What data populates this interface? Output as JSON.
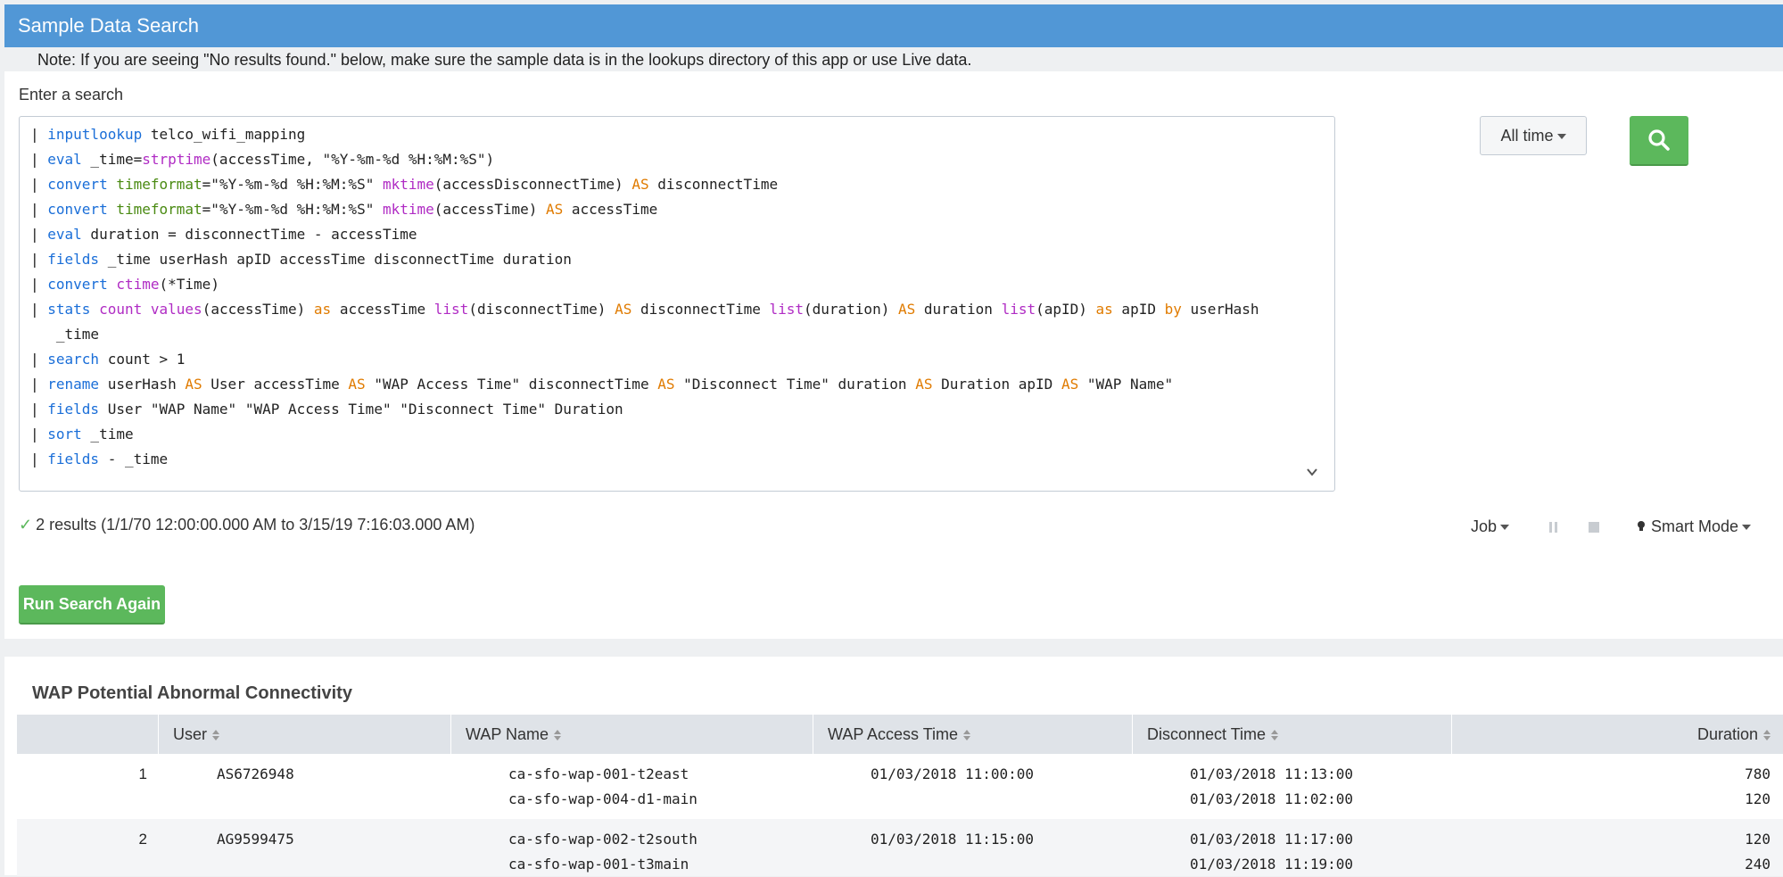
{
  "header": {
    "title": "Sample Data Search"
  },
  "note": "Note: If you are seeing \"No results found.\" below, make sure the sample data is in the lookups directory of this app or use Live data.",
  "search": {
    "label": "Enter a search",
    "lines": [
      [
        [
          "p",
          "| "
        ],
        [
          "kw",
          "inputlookup"
        ],
        [
          "p",
          " telco_wifi_mapping"
        ]
      ],
      [
        [
          "p",
          "| "
        ],
        [
          "kw",
          "eval"
        ],
        [
          "p",
          " _time="
        ],
        [
          "fn",
          "strptime"
        ],
        [
          "p",
          "(accessTime, \"%Y-%m-%d %H:%M:%S\")"
        ]
      ],
      [
        [
          "p",
          "| "
        ],
        [
          "kw",
          "convert"
        ],
        [
          "p",
          " "
        ],
        [
          "str",
          "timeformat"
        ],
        [
          "p",
          "=\"%Y-%m-%d %H:%M:%S\" "
        ],
        [
          "fn",
          "mktime"
        ],
        [
          "p",
          "(accessDisconnectTime) "
        ],
        [
          "op",
          "AS"
        ],
        [
          "p",
          " disconnectTime"
        ]
      ],
      [
        [
          "p",
          "| "
        ],
        [
          "kw",
          "convert"
        ],
        [
          "p",
          " "
        ],
        [
          "str",
          "timeformat"
        ],
        [
          "p",
          "=\"%Y-%m-%d %H:%M:%S\" "
        ],
        [
          "fn",
          "mktime"
        ],
        [
          "p",
          "(accessTime) "
        ],
        [
          "op",
          "AS"
        ],
        [
          "p",
          " accessTime"
        ]
      ],
      [
        [
          "p",
          "| "
        ],
        [
          "kw",
          "eval"
        ],
        [
          "p",
          " duration = disconnectTime - accessTime"
        ]
      ],
      [
        [
          "p",
          "| "
        ],
        [
          "kw",
          "fields"
        ],
        [
          "p",
          " _time userHash apID accessTime disconnectTime duration"
        ]
      ],
      [
        [
          "p",
          "| "
        ],
        [
          "kw",
          "convert"
        ],
        [
          "p",
          " "
        ],
        [
          "fn",
          "ctime"
        ],
        [
          "p",
          "(*Time)"
        ]
      ],
      [
        [
          "p",
          "| "
        ],
        [
          "kw",
          "stats"
        ],
        [
          "p",
          " "
        ],
        [
          "fn",
          "count"
        ],
        [
          "p",
          " "
        ],
        [
          "fn",
          "values"
        ],
        [
          "p",
          "(accessTime) "
        ],
        [
          "op",
          "as"
        ],
        [
          "p",
          " accessTime "
        ],
        [
          "fn",
          "list"
        ],
        [
          "p",
          "(disconnectTime) "
        ],
        [
          "op",
          "AS"
        ],
        [
          "p",
          " disconnectTime "
        ],
        [
          "fn",
          "list"
        ],
        [
          "p",
          "(duration) "
        ],
        [
          "op",
          "AS"
        ],
        [
          "p",
          " duration "
        ],
        [
          "fn",
          "list"
        ],
        [
          "p",
          "(apID) "
        ],
        [
          "op",
          "as"
        ],
        [
          "p",
          " apID "
        ],
        [
          "op",
          "by"
        ],
        [
          "p",
          " userHash"
        ]
      ],
      [
        [
          "p",
          "   _time"
        ]
      ],
      [
        [
          "p",
          "| "
        ],
        [
          "kw",
          "search"
        ],
        [
          "p",
          " count > 1"
        ]
      ],
      [
        [
          "p",
          "| "
        ],
        [
          "kw",
          "rename"
        ],
        [
          "p",
          " userHash "
        ],
        [
          "op",
          "AS"
        ],
        [
          "p",
          " User accessTime "
        ],
        [
          "op",
          "AS"
        ],
        [
          "p",
          " \"WAP Access Time\" disconnectTime "
        ],
        [
          "op",
          "AS"
        ],
        [
          "p",
          " \"Disconnect Time\" duration "
        ],
        [
          "op",
          "AS"
        ],
        [
          "p",
          " Duration apID "
        ],
        [
          "op",
          "AS"
        ],
        [
          "p",
          " \"WAP Name\""
        ]
      ],
      [
        [
          "p",
          "| "
        ],
        [
          "kw",
          "fields"
        ],
        [
          "p",
          " User \"WAP Name\" \"WAP Access Time\" \"Disconnect Time\" Duration"
        ]
      ],
      [
        [
          "p",
          "| "
        ],
        [
          "kw",
          "sort"
        ],
        [
          "p",
          " _time"
        ]
      ],
      [
        [
          "p",
          "| "
        ],
        [
          "kw",
          "fields"
        ],
        [
          "p",
          " - _time"
        ]
      ]
    ]
  },
  "time_picker": {
    "label": "All time"
  },
  "status": {
    "results_text": "2 results (1/1/70 12:00:00.000 AM to 3/15/19 7:16:03.000 AM)"
  },
  "job_menu": {
    "label": "Job"
  },
  "mode_menu": {
    "label": "Smart Mode"
  },
  "run_button": {
    "label": "Run Search Again"
  },
  "results": {
    "title": "WAP Potential Abnormal Connectivity",
    "columns": [
      "User",
      "WAP Name",
      "WAP Access Time",
      "Disconnect Time",
      "Duration"
    ],
    "rows": [
      {
        "index": "1",
        "user": "AS6726948",
        "wap_names": [
          "ca-sfo-wap-001-t2east",
          "ca-sfo-wap-004-d1-main"
        ],
        "access_time": "01/03/2018 11:00:00",
        "disconnect_times": [
          "01/03/2018 11:13:00",
          "01/03/2018 11:02:00"
        ],
        "durations": [
          "780",
          "120"
        ]
      },
      {
        "index": "2",
        "user": "AG9599475",
        "wap_names": [
          "ca-sfo-wap-002-t2south",
          "ca-sfo-wap-001-t3main"
        ],
        "access_time": "01/03/2018 11:15:00",
        "disconnect_times": [
          "01/03/2018 11:17:00",
          "01/03/2018 11:19:00"
        ],
        "durations": [
          "120",
          "240"
        ]
      }
    ]
  }
}
